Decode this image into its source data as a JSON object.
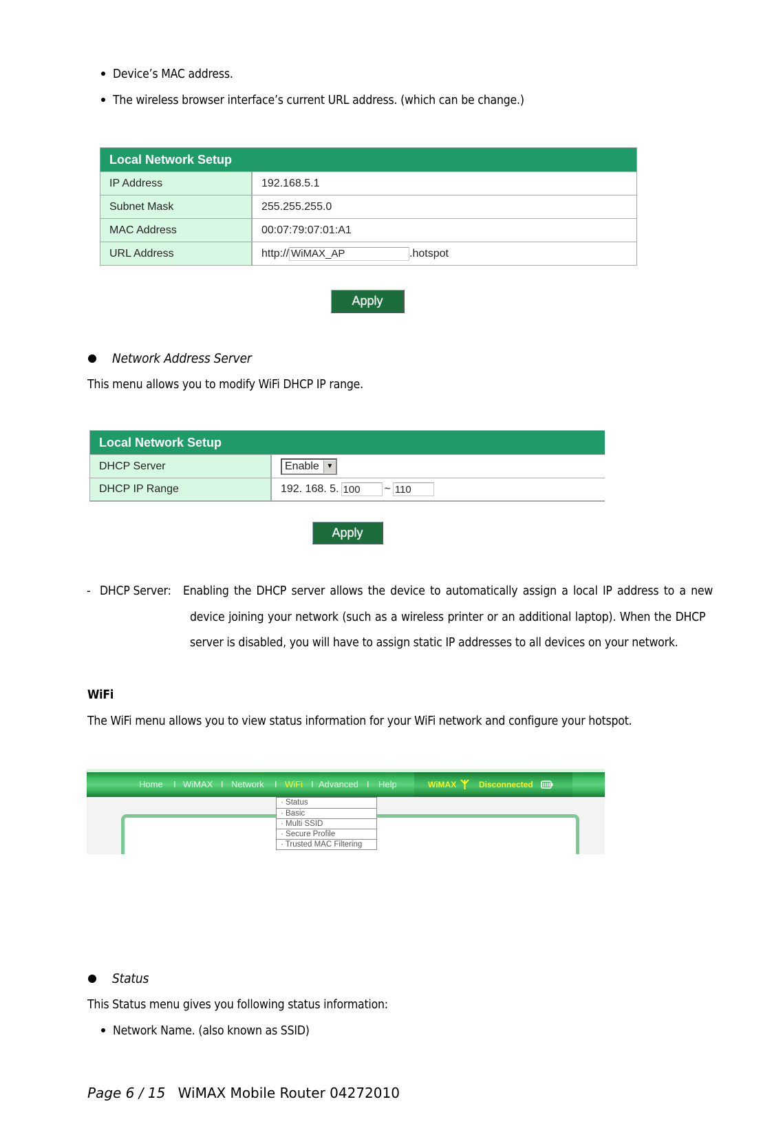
{
  "intro_bullets": [
    "Device’s MAC address.",
    "The wireless browser interface’s current URL address. (which can be change.)"
  ],
  "table1": {
    "title": "Local Network Setup",
    "rows": [
      {
        "label": "IP Address",
        "value": "192.168.5.1"
      },
      {
        "label": "Subnet Mask",
        "value": "255.255.255.0"
      },
      {
        "label": "MAC Address",
        "value": "00:07:79:07:01:A1"
      },
      {
        "label": "URL Address",
        "prefix": "http://",
        "input_value": "WiMAX_AP",
        "suffix": ".hotspot"
      }
    ],
    "apply_label": "Apply"
  },
  "section_nas": {
    "heading": "Network Address Server",
    "description": "This menu allows you to modify WiFi DHCP IP range."
  },
  "table2": {
    "title": "Local Network Setup",
    "dhcp_server_label": "DHCP Server",
    "dhcp_server_value": "Enable",
    "dhcp_range_label": "DHCP IP Range",
    "dhcp_range_prefix": "192. 168. 5.",
    "dhcp_range_start": "100",
    "dhcp_range_sep": "~",
    "dhcp_range_end": "110",
    "apply_label": "Apply"
  },
  "dhcp_note": {
    "dash": "-",
    "term": "DHCP Server:",
    "line1": "Enabling the DHCP server allows the device to automatically assign a local IP address to a new",
    "line2": "device joining your network (such as a wireless printer or an additional laptop). When the DHCP",
    "line3": "server is disabled, you will have to assign static IP addresses to all devices on your network."
  },
  "wifi_section": {
    "heading": "WiFi",
    "description": "The WiFi menu allows you to view status information for your WiFi network and configure your hotspot."
  },
  "navshot": {
    "nav_items": [
      "Home",
      "WiMAX",
      "Network",
      "WiFi",
      "Advanced",
      "Help"
    ],
    "separator": "I",
    "active_item": "WiFi",
    "status_network": "WiMAX",
    "status_connection": "Disconnected",
    "icons": [
      "antenna-icon",
      "battery-icon"
    ],
    "dropdown_items": [
      "Status",
      "Basic",
      "Multi SSID",
      "Secure Profile",
      "Trusted MAC Filtering"
    ],
    "colors": {
      "nav_green": "#3fbf62",
      "active_yellow": "#f5f52a"
    }
  },
  "status_section": {
    "heading": "Status",
    "description": "This Status menu gives you following status information:",
    "bullets": [
      "Network Name. (also known as SSID)"
    ]
  },
  "footer": {
    "page": "Page 6 / 15",
    "title": "WiMAX Mobile Router 04272010"
  },
  "colors": {
    "header_green": "#1f9a69",
    "label_bg": "#d7f8e3",
    "apply_green": "#1b6d3c"
  }
}
